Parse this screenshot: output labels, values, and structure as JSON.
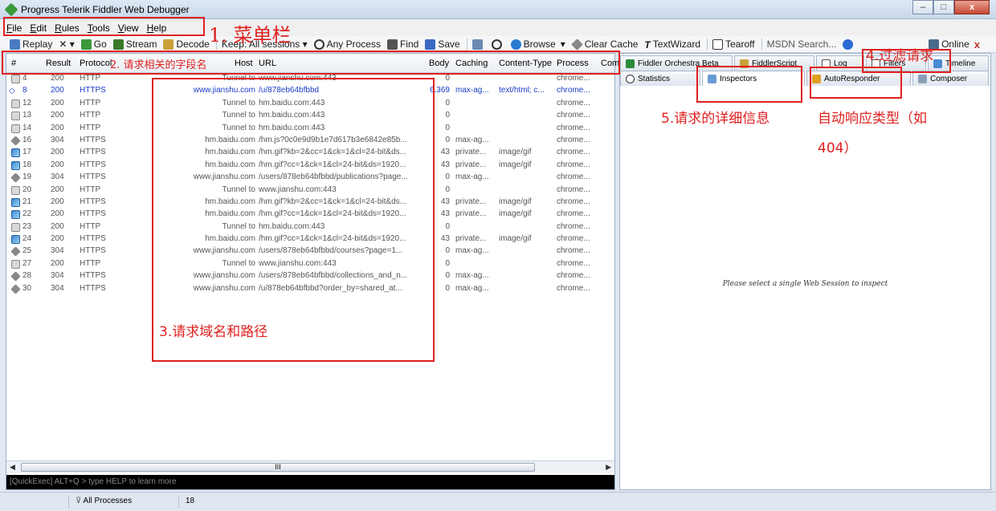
{
  "window": {
    "title": "Progress Telerik Fiddler Web Debugger",
    "min": "–",
    "max": "□",
    "close": "x"
  },
  "menu": [
    {
      "u": "F",
      "rest": "ile"
    },
    {
      "u": "E",
      "rest": "dit"
    },
    {
      "u": "R",
      "rest": "ules"
    },
    {
      "u": "T",
      "rest": "ools"
    },
    {
      "u": "V",
      "rest": "iew"
    },
    {
      "u": "H",
      "rest": "elp"
    }
  ],
  "toolbar": {
    "replay": "Replay",
    "remove": "✕ ▾",
    "go": "Go",
    "stream": "Stream",
    "decode": "Decode",
    "keep": "Keep: All sessions ▾",
    "process": "Any Process",
    "find": "Find",
    "save": "Save",
    "browse": "Browse",
    "browse_arrow": "▾",
    "clearcache": "Clear Cache",
    "textwizard": "TextWizard",
    "tearoff": "Tearoff",
    "msdn": "MSDN Search...",
    "online": "Online",
    "close_x": "x"
  },
  "columns": {
    "num": "#",
    "result": "Result",
    "protocol": "Protocol",
    "host": "Host",
    "url": "URL",
    "body": "Body",
    "caching": "Caching",
    "content_type": "Content-Type",
    "process": "Process",
    "comments": "Com"
  },
  "sessions": [
    {
      "id": "4",
      "icon": "lock-icon",
      "result": "200",
      "protocol": "HTTP",
      "host": "Tunnel to",
      "url": "www.jianshu.com:443",
      "body": "0",
      "caching": "",
      "ctype": "",
      "process": "chrome..."
    },
    {
      "id": "8",
      "icon": "arrows-icon",
      "result": "200",
      "protocol": "HTTPS",
      "host": "www.jianshu.com",
      "url": "/u/878eb64bfbbd",
      "body": "6,369",
      "caching": "max-ag...",
      "ctype": "text/html; c...",
      "process": "chrome..."
    },
    {
      "id": "12",
      "icon": "lock-icon",
      "result": "200",
      "protocol": "HTTP",
      "host": "Tunnel to",
      "url": "hm.baidu.com:443",
      "body": "0",
      "caching": "",
      "ctype": "",
      "process": "chrome..."
    },
    {
      "id": "13",
      "icon": "lock-icon",
      "result": "200",
      "protocol": "HTTP",
      "host": "Tunnel to",
      "url": "hm.baidu.com:443",
      "body": "0",
      "caching": "",
      "ctype": "",
      "process": "chrome..."
    },
    {
      "id": "14",
      "icon": "lock-icon",
      "result": "200",
      "protocol": "HTTP",
      "host": "Tunnel to",
      "url": "hm.baidu.com:443",
      "body": "0",
      "caching": "",
      "ctype": "",
      "process": "chrome..."
    },
    {
      "id": "16",
      "icon": "diamond-icon",
      "result": "304",
      "protocol": "HTTPS",
      "host": "hm.baidu.com",
      "url": "/hm.js?0c0e9d9b1e7d617b3e6842e85b...",
      "body": "0",
      "caching": "max-ag...",
      "ctype": "",
      "process": "chrome..."
    },
    {
      "id": "17",
      "icon": "image-icon",
      "result": "200",
      "protocol": "HTTPS",
      "host": "hm.baidu.com",
      "url": "/hm.gif?kb=2&cc=1&ck=1&cl=24-bit&ds...",
      "body": "43",
      "caching": "private...",
      "ctype": "image/gif",
      "process": "chrome..."
    },
    {
      "id": "18",
      "icon": "image-icon",
      "result": "200",
      "protocol": "HTTPS",
      "host": "hm.baidu.com",
      "url": "/hm.gif?cc=1&ck=1&cl=24-bit&ds=1920...",
      "body": "43",
      "caching": "private...",
      "ctype": "image/gif",
      "process": "chrome..."
    },
    {
      "id": "19",
      "icon": "diamond-icon",
      "result": "304",
      "protocol": "HTTPS",
      "host": "www.jianshu.com",
      "url": "/users/878eb64bfbbd/publications?page...",
      "body": "0",
      "caching": "max-ag...",
      "ctype": "",
      "process": "chrome..."
    },
    {
      "id": "20",
      "icon": "lock-icon",
      "result": "200",
      "protocol": "HTTP",
      "host": "Tunnel to",
      "url": "www.jianshu.com:443",
      "body": "0",
      "caching": "",
      "ctype": "",
      "process": "chrome..."
    },
    {
      "id": "21",
      "icon": "image-icon",
      "result": "200",
      "protocol": "HTTPS",
      "host": "hm.baidu.com",
      "url": "/hm.gif?kb=2&cc=1&ck=1&cl=24-bit&ds...",
      "body": "43",
      "caching": "private...",
      "ctype": "image/gif",
      "process": "chrome..."
    },
    {
      "id": "22",
      "icon": "image-icon",
      "result": "200",
      "protocol": "HTTPS",
      "host": "hm.baidu.com",
      "url": "/hm.gif?cc=1&ck=1&cl=24-bit&ds=1920...",
      "body": "43",
      "caching": "private...",
      "ctype": "image/gif",
      "process": "chrome..."
    },
    {
      "id": "23",
      "icon": "lock-icon",
      "result": "200",
      "protocol": "HTTP",
      "host": "Tunnel to",
      "url": "hm.baidu.com:443",
      "body": "0",
      "caching": "",
      "ctype": "",
      "process": "chrome..."
    },
    {
      "id": "24",
      "icon": "image-icon",
      "result": "200",
      "protocol": "HTTPS",
      "host": "hm.baidu.com",
      "url": "/hm.gif?cc=1&ck=1&cl=24-bit&ds=1920...",
      "body": "43",
      "caching": "private...",
      "ctype": "image/gif",
      "process": "chrome..."
    },
    {
      "id": "25",
      "icon": "diamond-icon",
      "result": "304",
      "protocol": "HTTPS",
      "host": "www.jianshu.com",
      "url": "/users/878eb64bfbbd/courses?page=1...",
      "body": "0",
      "caching": "max-ag...",
      "ctype": "",
      "process": "chrome..."
    },
    {
      "id": "27",
      "icon": "lock-icon",
      "result": "200",
      "protocol": "HTTP",
      "host": "Tunnel to",
      "url": "www.jianshu.com:443",
      "body": "0",
      "caching": "",
      "ctype": "",
      "process": "chrome..."
    },
    {
      "id": "28",
      "icon": "diamond-icon",
      "result": "304",
      "protocol": "HTTPS",
      "host": "www.jianshu.com",
      "url": "/users/878eb64bfbbd/collections_and_n...",
      "body": "0",
      "caching": "max-ag...",
      "ctype": "",
      "process": "chrome..."
    },
    {
      "id": "30",
      "icon": "diamond-icon",
      "result": "304",
      "protocol": "HTTPS",
      "host": "www.jianshu.com",
      "url": "/u/878eb64bfbbd?order_by=shared_at...",
      "body": "0",
      "caching": "max-ag...",
      "ctype": "",
      "process": "chrome..."
    }
  ],
  "scroll_thumb": "III",
  "quickexec": "[QuickExec] ALT+Q > type HELP to learn more",
  "tabs_row1": [
    {
      "label": "Fiddler Orchestra Beta",
      "icon": "orchestra-icon"
    },
    {
      "label": "FiddlerScript",
      "icon": "script-icon"
    },
    {
      "label": "Log",
      "icon": "log-icon"
    },
    {
      "label": "Filters",
      "icon": "checkbox-icon"
    },
    {
      "label": "Timeline",
      "icon": "timeline-icon"
    }
  ],
  "tabs_row2": [
    {
      "label": "Statistics",
      "icon": "clock-icon"
    },
    {
      "label": "Inspectors",
      "icon": "inspect-icon"
    },
    {
      "label": "AutoResponder",
      "icon": "bolt-icon"
    },
    {
      "label": "Composer",
      "icon": "pencil-icon"
    }
  ],
  "inspect_message": "Please select a single Web Session to inspect",
  "status": {
    "filter": "All Processes",
    "count": "18"
  },
  "annotations": {
    "a1": "1. 菜单栏",
    "a2": "2. 请求相关的字段名",
    "a3": "3.请求域名和路径",
    "a4": "4.过滤请求",
    "a5": "5.请求的详细信息",
    "a6_line1": "自动响应类型（如",
    "a6_line2": "404）"
  },
  "colors": {
    "annotation": "#e02020",
    "selected_row": "#1a3cc8"
  }
}
